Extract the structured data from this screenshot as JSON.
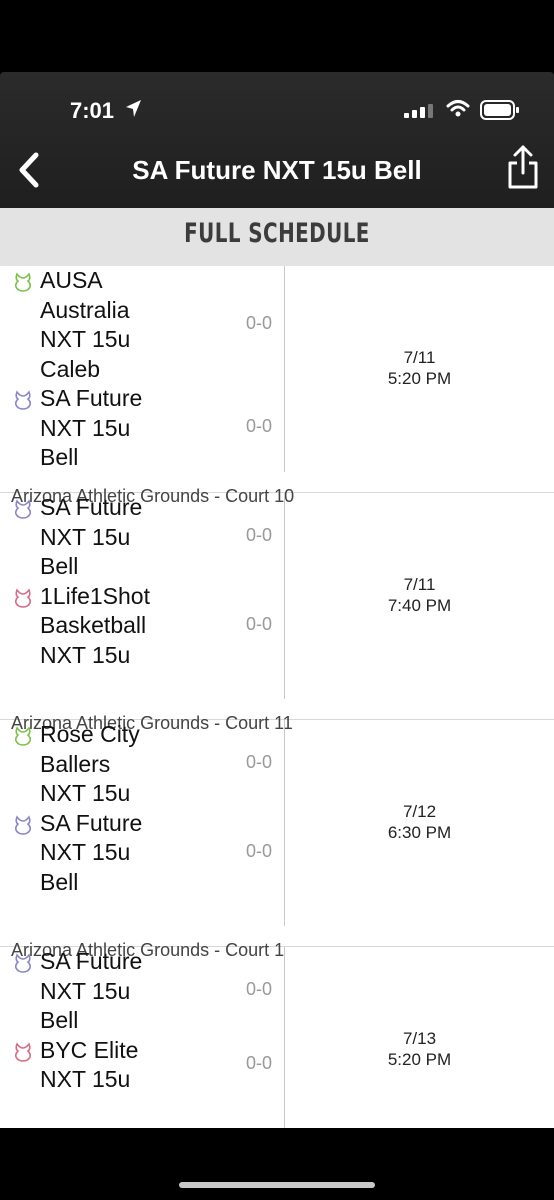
{
  "status_bar": {
    "time": "7:01"
  },
  "header": {
    "title": "SA Future NXT 15u Bell"
  },
  "section_title": "FULL SCHEDULE",
  "colors": {
    "green": "#7cc24a",
    "purple": "#8b86c9",
    "pink": "#d86b86"
  },
  "games": [
    {
      "teams": [
        {
          "name_lines": [
            "AUSA",
            "Australia",
            "NXT 15u",
            "Caleb"
          ],
          "score": "0-0",
          "icon": "trophy-icon",
          "color": "green"
        },
        {
          "name_lines": [
            "SA Future",
            "NXT 15u",
            "Bell"
          ],
          "score": "0-0",
          "icon": "trophy-icon",
          "color": "purple"
        }
      ],
      "date": "7/11",
      "time": "5:20 PM",
      "venue": "Arizona Athletic Grounds - Court 10"
    },
    {
      "teams": [
        {
          "name_lines": [
            "SA Future",
            "NXT 15u",
            "Bell"
          ],
          "score": "0-0",
          "icon": "trophy-icon",
          "color": "purple"
        },
        {
          "name_lines": [
            "1Life1Shot",
            "Basketball",
            "NXT 15u"
          ],
          "score": "0-0",
          "icon": "trophy-icon",
          "color": "pink"
        }
      ],
      "date": "7/11",
      "time": "7:40 PM",
      "venue": "Arizona Athletic Grounds - Court 11"
    },
    {
      "teams": [
        {
          "name_lines": [
            "Rose City",
            "Ballers",
            "NXT 15u"
          ],
          "score": "0-0",
          "icon": "trophy-icon",
          "color": "green"
        },
        {
          "name_lines": [
            "SA Future",
            "NXT 15u",
            "Bell"
          ],
          "score": "0-0",
          "icon": "trophy-icon",
          "color": "purple"
        }
      ],
      "date": "7/12",
      "time": "6:30 PM",
      "venue": "Arizona Athletic Grounds - Court 1"
    },
    {
      "teams": [
        {
          "name_lines": [
            "SA Future",
            "NXT 15u",
            "Bell"
          ],
          "score": "0-0",
          "icon": "trophy-icon",
          "color": "purple"
        },
        {
          "name_lines": [
            "BYC Elite",
            "NXT 15u"
          ],
          "score": "0-0",
          "icon": "trophy-icon",
          "color": "pink"
        }
      ],
      "date": "7/13",
      "time": "5:20 PM",
      "venue": ""
    }
  ]
}
